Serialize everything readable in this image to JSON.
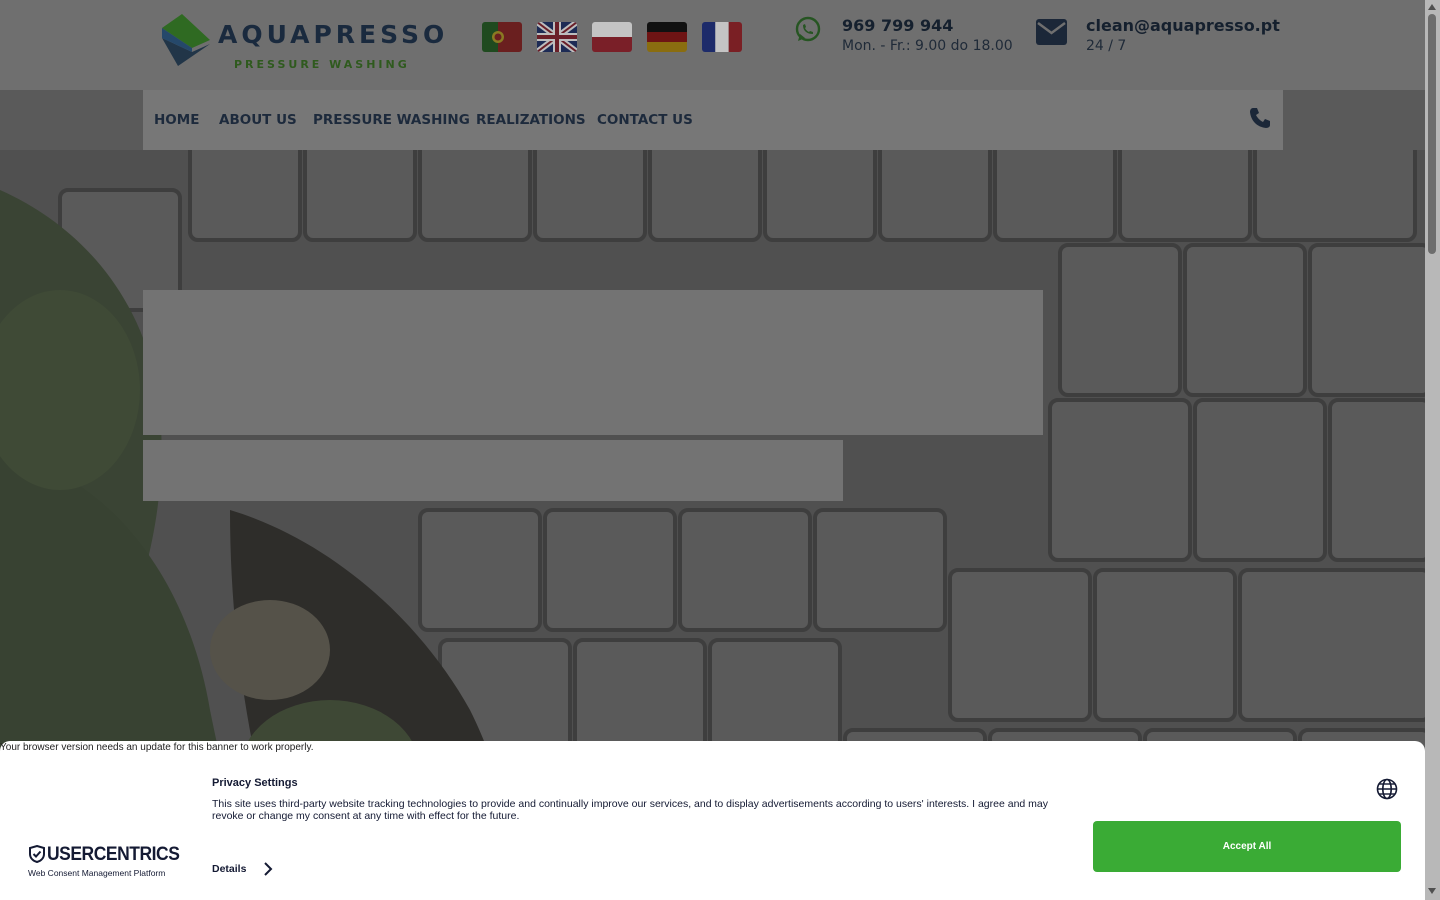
{
  "header": {
    "logo": {
      "brand": "AQUAPRESSO",
      "tagline": "PRESSURE WASHING"
    },
    "languages": [
      {
        "name": "Portuguese",
        "icon": "flag-portugal"
      },
      {
        "name": "English",
        "icon": "flag-uk"
      },
      {
        "name": "Polish",
        "icon": "flag-poland"
      },
      {
        "name": "German",
        "icon": "flag-germany"
      },
      {
        "name": "French",
        "icon": "flag-france"
      }
    ],
    "phone": {
      "number": "969 799 944",
      "hours": "Mon. - Fr.: 9.00 do 18.00",
      "icon": "whatsapp-icon"
    },
    "email": {
      "address": "clean@aquapresso.pt",
      "availability": "24 / 7",
      "icon": "envelope-icon"
    }
  },
  "nav": {
    "items": [
      "HOME",
      "ABOUT US",
      "PRESSURE WASHING",
      "REALIZATIONS",
      "CONTACT US"
    ],
    "phone_icon": "phone-icon"
  },
  "consent": {
    "update_notice": "Your browser version needs an update for this banner to work properly.",
    "title": "Privacy Settings",
    "body": "This site uses third-party website tracking technologies to provide and continually improve our services, and to display advertisements according to users' interests. I agree and may revoke or change my consent at any time with effect for the future.",
    "details_label": "Details",
    "accept_label": "Accept All",
    "brand": "USERCENTRICS",
    "brand_sub": "Web Consent Management Platform"
  },
  "colors": {
    "accent_green": "#3aab35",
    "navy": "#141a33",
    "overlay": "#6f6f6f"
  }
}
